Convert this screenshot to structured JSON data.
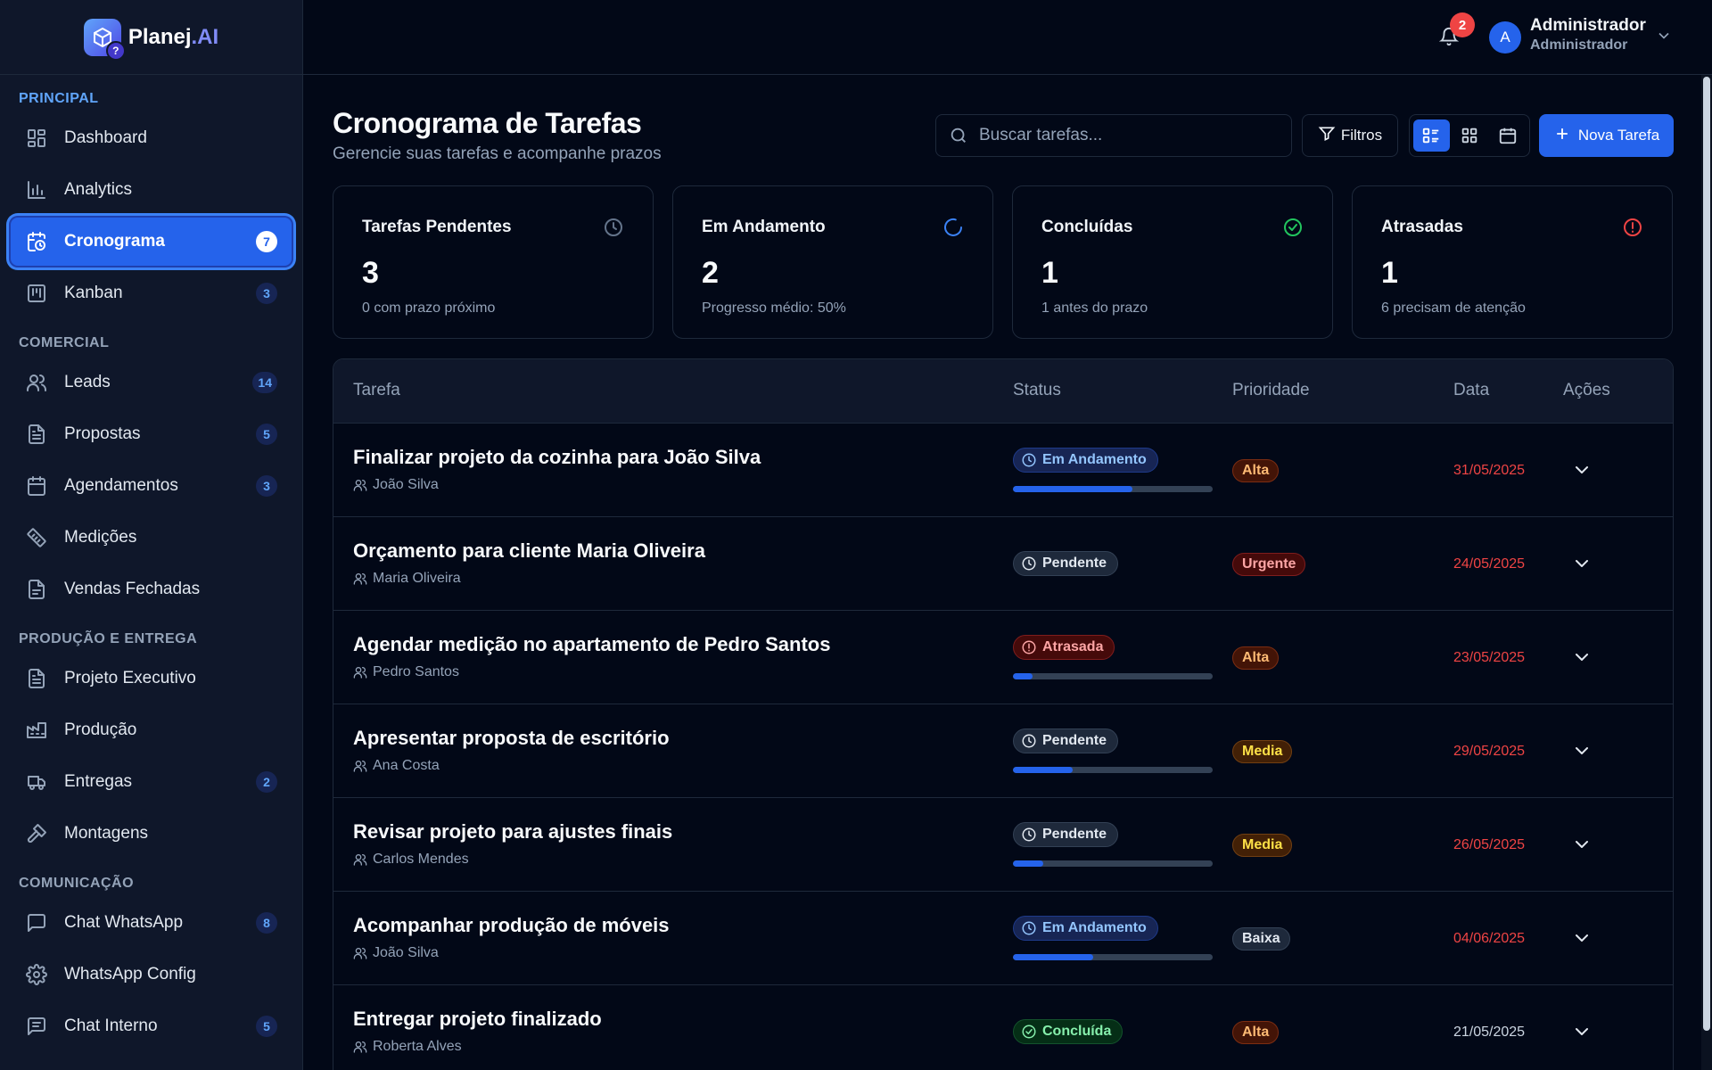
{
  "brand": {
    "name": "Planej",
    "suffix": ".AI",
    "mark_glyph": "?"
  },
  "sidebar": {
    "sections": [
      {
        "label": "PRINCIPAL",
        "items": [
          {
            "label": "Dashboard",
            "icon": "dashboard-icon",
            "badge": ""
          },
          {
            "label": "Analytics",
            "icon": "bar-chart-icon",
            "badge": ""
          },
          {
            "label": "Cronograma",
            "icon": "calendar-clock-icon",
            "badge": "7",
            "active": true
          },
          {
            "label": "Kanban",
            "icon": "kanban-icon",
            "badge": "3"
          }
        ]
      },
      {
        "label": "COMERCIAL",
        "items": [
          {
            "label": "Leads",
            "icon": "users-icon",
            "badge": "14"
          },
          {
            "label": "Propostas",
            "icon": "document-icon",
            "badge": "5"
          },
          {
            "label": "Agendamentos",
            "icon": "calendar-icon",
            "badge": "3"
          },
          {
            "label": "Medições",
            "icon": "ruler-icon",
            "badge": ""
          },
          {
            "label": "Vendas Fechadas",
            "icon": "document-check-icon",
            "badge": ""
          }
        ]
      },
      {
        "label": "PRODUÇÃO E ENTREGA",
        "items": [
          {
            "label": "Projeto Executivo",
            "icon": "document-icon",
            "badge": ""
          },
          {
            "label": "Produção",
            "icon": "factory-icon",
            "badge": ""
          },
          {
            "label": "Entregas",
            "icon": "truck-icon",
            "badge": "2"
          },
          {
            "label": "Montagens",
            "icon": "hammer-icon",
            "badge": ""
          }
        ]
      },
      {
        "label": "COMUNICAÇÃO",
        "items": [
          {
            "label": "Chat WhatsApp",
            "icon": "message-square-icon",
            "badge": "8"
          },
          {
            "label": "WhatsApp Config",
            "icon": "gear-icon",
            "badge": ""
          },
          {
            "label": "Chat Interno",
            "icon": "message-lines-icon",
            "badge": "5"
          }
        ]
      }
    ]
  },
  "topbar": {
    "notifications": "2",
    "user": {
      "initial": "A",
      "name": "Administrador",
      "role": "Administrador"
    }
  },
  "page": {
    "title": "Cronograma de Tarefas",
    "subtitle": "Gerencie suas tarefas e acompanhe prazos",
    "search_placeholder": "Buscar tarefas...",
    "filter_label": "Filtros",
    "new_task_label": "Nova Tarefa",
    "views": [
      "list-view-icon",
      "grid-view-icon",
      "calendar-view-icon"
    ]
  },
  "stats": [
    {
      "title": "Tarefas Pendentes",
      "value": "3",
      "sub": "0 com prazo próximo",
      "icon": "clock-icon",
      "color": "#64748b"
    },
    {
      "title": "Em Andamento",
      "value": "2",
      "sub": "Progresso médio: 50%",
      "icon": "spinner-icon",
      "color": "#3b82f6"
    },
    {
      "title": "Concluídas",
      "value": "1",
      "sub": "1 antes do prazo",
      "icon": "check-circle-icon",
      "color": "#22c55e"
    },
    {
      "title": "Atrasadas",
      "value": "1",
      "sub": "6 precisam de atenção",
      "icon": "alert-circle-icon",
      "color": "#ef4444"
    }
  ],
  "table": {
    "headers": [
      "Tarefa",
      "Status",
      "Prioridade",
      "Data",
      "Ações"
    ],
    "rows": [
      {
        "task": "Finalizar projeto da cozinha para João Silva",
        "client": "João Silva",
        "status": "Em Andamento",
        "status_kind": "andamento",
        "progress": 0.6,
        "priority": "Alta",
        "priority_kind": "alta",
        "date": "31/05/2025",
        "late": true
      },
      {
        "task": "Orçamento para cliente Maria Oliveira",
        "client": "Maria Oliveira",
        "status": "Pendente",
        "status_kind": "pendente",
        "progress": null,
        "priority": "Urgente",
        "priority_kind": "urgente",
        "date": "24/05/2025",
        "late": true
      },
      {
        "task": "Agendar medição no apartamento de Pedro Santos",
        "client": "Pedro Santos",
        "status": "Atrasada",
        "status_kind": "atrasada",
        "progress": 0.1,
        "priority": "Alta",
        "priority_kind": "alta",
        "date": "23/05/2025",
        "late": true
      },
      {
        "task": "Apresentar proposta de escritório",
        "client": "Ana Costa",
        "status": "Pendente",
        "status_kind": "pendente",
        "progress": 0.3,
        "priority": "Media",
        "priority_kind": "media",
        "date": "29/05/2025",
        "late": true
      },
      {
        "task": "Revisar projeto para ajustes finais",
        "client": "Carlos Mendes",
        "status": "Pendente",
        "status_kind": "pendente",
        "progress": 0.15,
        "priority": "Media",
        "priority_kind": "media",
        "date": "26/05/2025",
        "late": true
      },
      {
        "task": "Acompanhar produção de móveis",
        "client": "João Silva",
        "status": "Em Andamento",
        "status_kind": "andamento",
        "progress": 0.4,
        "priority": "Baixa",
        "priority_kind": "baixa",
        "date": "04/06/2025",
        "late": true
      },
      {
        "task": "Entregar projeto finalizado",
        "client": "Roberta Alves",
        "status": "Concluída",
        "status_kind": "concluida",
        "progress": null,
        "priority": "Alta",
        "priority_kind": "alta",
        "date": "21/05/2025",
        "late": false
      }
    ]
  }
}
